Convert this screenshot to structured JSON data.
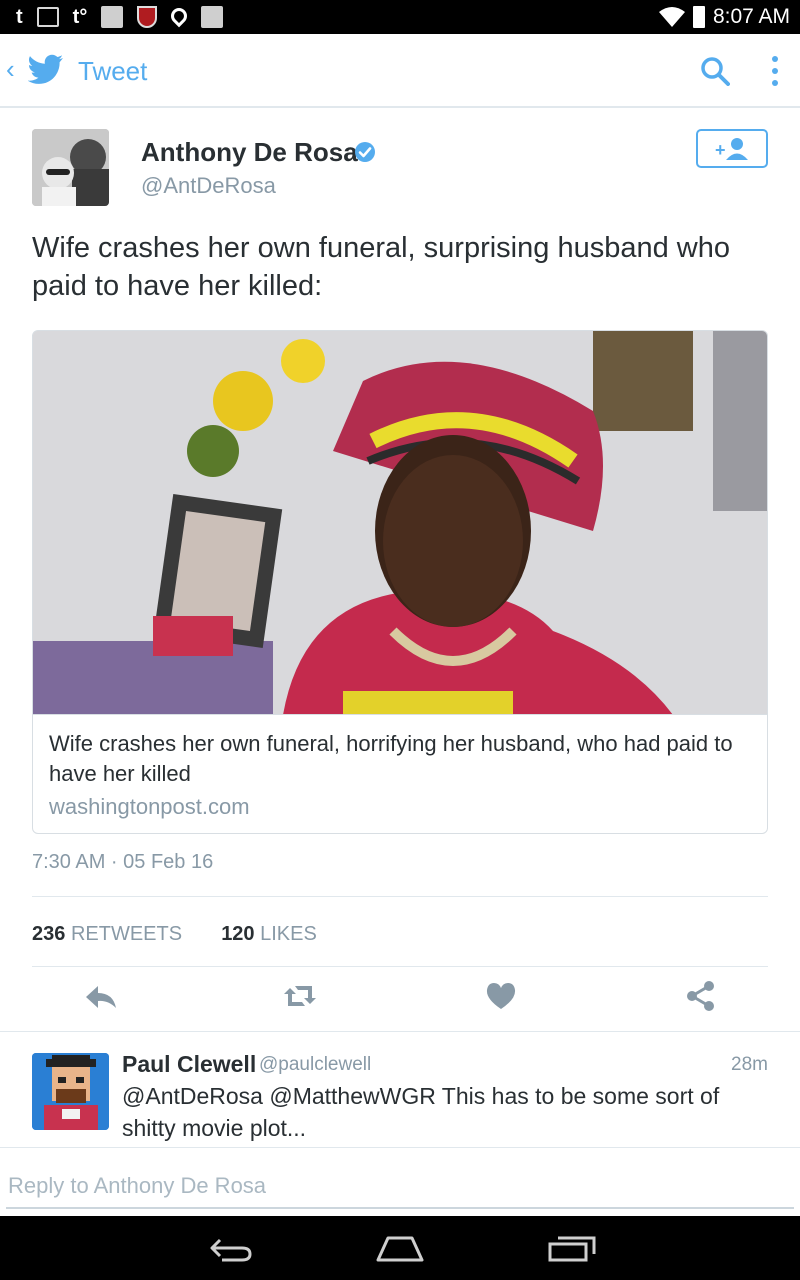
{
  "status_bar": {
    "left_icons": [
      "tumblr-icon",
      "image-icon",
      "tumblr-notify-icon",
      "bible-icon",
      "shield-icon",
      "location-pin-icon",
      "bible-icon"
    ],
    "tumblr_glyph": "t",
    "tumblr_notify_glyph": "t°",
    "time": "8:07 AM"
  },
  "app_bar": {
    "back_glyph": "‹",
    "title": "Tweet",
    "accent_color": "#55acee"
  },
  "tweet": {
    "author_name": "Anthony De Rosa",
    "author_handle": "@AntDeRosa",
    "text": "Wife crashes her own funeral, surprising husband who paid to have her killed:",
    "card": {
      "title": "Wife crashes her own funeral, horrifying her husband, who had paid to have her killed",
      "domain": "washingtonpost.com"
    },
    "timestamp": "7:30 AM · 05 Feb 16",
    "retweet_count": "236",
    "retweet_label": "RETWEETS",
    "like_count": "120",
    "like_label": "LIKES"
  },
  "reply": {
    "author_name": "Paul Clewell",
    "author_handle": "@paulclewell",
    "time": "28m",
    "text": "@AntDeRosa @MatthewWGR This has to be some sort of shitty movie plot..."
  },
  "compose": {
    "placeholder": "Reply to Anthony De Rosa"
  },
  "colors": {
    "accent": "#55acee",
    "text": "#292f33",
    "secondary": "#8899a6",
    "action_icon": "#8899a6"
  }
}
